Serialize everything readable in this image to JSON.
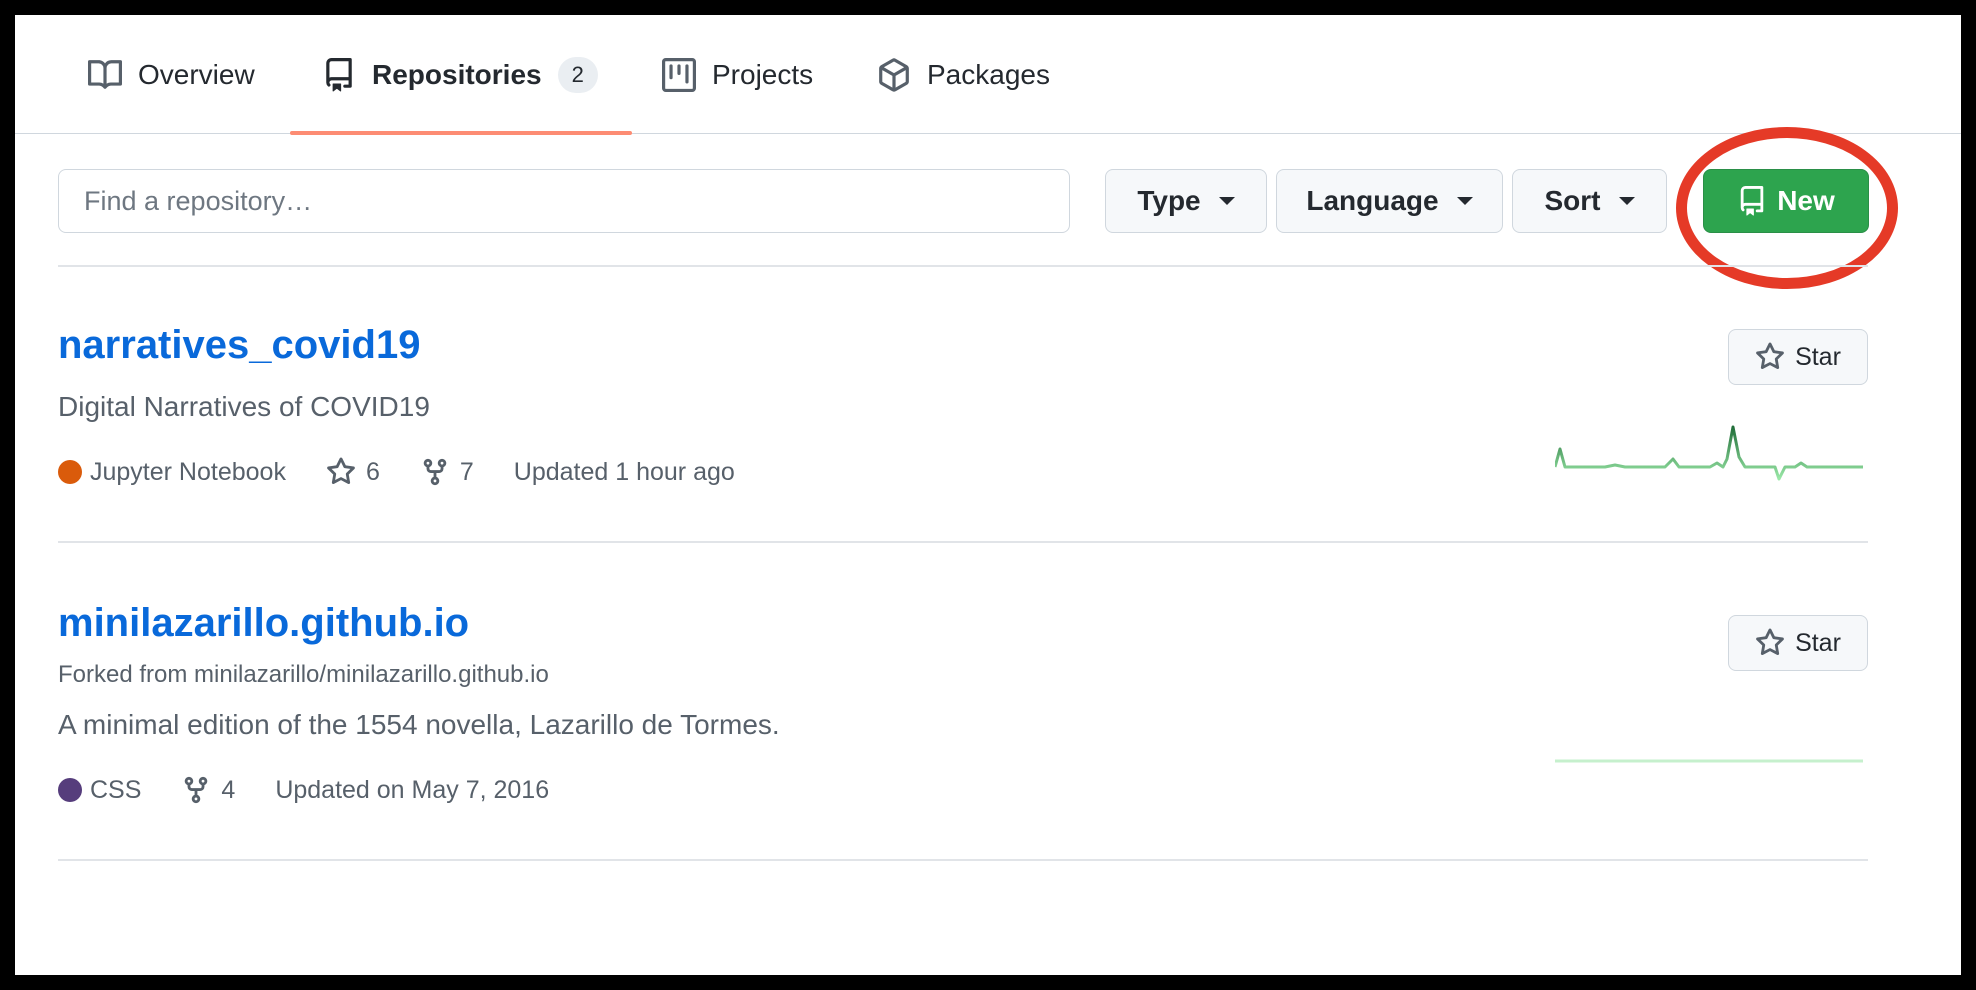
{
  "tabs": [
    {
      "label": "Overview",
      "icon": "book-icon"
    },
    {
      "label": "Repositories",
      "icon": "repo-icon",
      "count": "2"
    },
    {
      "label": "Projects",
      "icon": "project-icon"
    },
    {
      "label": "Packages",
      "icon": "package-icon"
    }
  ],
  "filters": {
    "search_placeholder": "Find a repository…",
    "type_label": "Type",
    "language_label": "Language",
    "sort_label": "Sort",
    "new_label": "New"
  },
  "repos": [
    {
      "name": "narratives_covid19",
      "description": "Digital Narratives of COVID19",
      "language": "Jupyter Notebook",
      "language_color": "#DA5B0B",
      "stars": "6",
      "forks": "7",
      "updated": "Updated 1 hour ago",
      "star_label": "Star"
    },
    {
      "name": "minilazarillo.github.io",
      "forked_from": "Forked from minilazarillo/minilazarillo.github.io",
      "description": "A minimal edition of the 1554 novella, Lazarillo de Tormes.",
      "language": "CSS",
      "language_color": "#563d7c",
      "forks": "4",
      "updated": "Updated on May 7, 2016",
      "star_label": "Star"
    }
  ],
  "colors": {
    "link": "#0969da",
    "primary_button": "#2da44e",
    "highlight_ring": "#e53a27",
    "tab_underline": "#fd8c73",
    "sparkline": "#40c463"
  }
}
